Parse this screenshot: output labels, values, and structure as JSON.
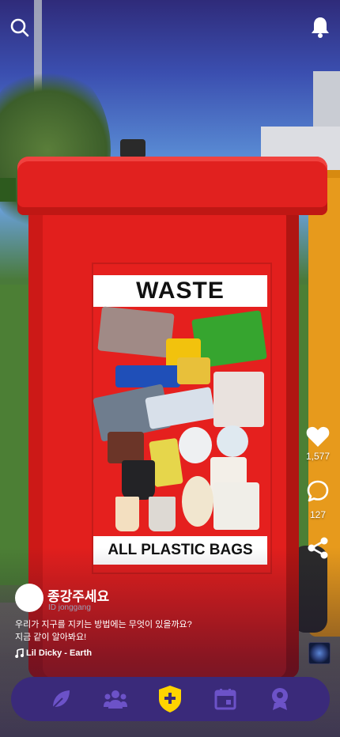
{
  "colors": {
    "accent": "#ffd400",
    "nav_bg": "#3a2a7a",
    "nav_icon": "#6c52c8"
  },
  "top_bar": {
    "search_icon": "search-icon",
    "bell_icon": "bell-icon"
  },
  "media": {
    "sign_top": "WASTE",
    "sign_bottom": "ALL PLASTIC BAGS"
  },
  "actions": {
    "likes": "1,577",
    "comments": "127"
  },
  "post": {
    "username": "종강주세요",
    "user_id": "ID jonggang",
    "caption": "우리가 지구를 지키는 방법에는 무엇이 있을까요?\n지금 같이 알아봐요!",
    "music": "Lil Dicky - Earth"
  },
  "nav": {
    "items": [
      "leaf-icon",
      "group-icon",
      "add-shield-icon",
      "calendar-icon",
      "profile-icon"
    ],
    "active": 2
  }
}
